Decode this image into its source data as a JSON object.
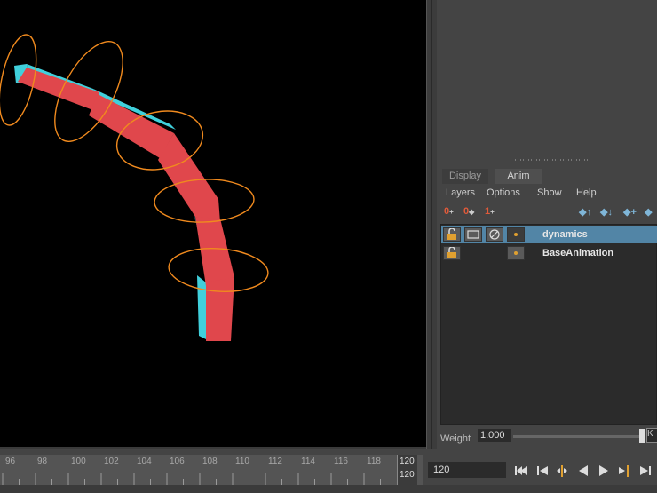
{
  "panel": {
    "tabs": [
      {
        "label": "Display",
        "active": false
      },
      {
        "label": "Anim",
        "active": true
      }
    ],
    "menu": [
      "Layers",
      "Options",
      "Show",
      "Help"
    ],
    "toolbar_left": [
      "0",
      "0",
      "1"
    ],
    "layers": [
      {
        "name": "dynamics",
        "selected": true
      },
      {
        "name": "BaseAnimation",
        "selected": false
      }
    ],
    "weight": {
      "label": "Weight",
      "value": "1.000",
      "key_button": "K"
    }
  },
  "timeline": {
    "ticks": [
      "96",
      "98",
      "100",
      "102",
      "104",
      "106",
      "108",
      "110",
      "112",
      "114",
      "116",
      "118",
      "120"
    ],
    "current_frame": "120"
  },
  "playback": {
    "frame_field": "120",
    "buttons": [
      "go-to-start",
      "step-back-key",
      "step-back-frame",
      "play-back",
      "play-forward",
      "step-forward-key",
      "go-to-end"
    ]
  },
  "colors": {
    "chain_front": "#e0474c",
    "chain_side": "#40d0dc",
    "controls": "#f08a1e",
    "selection": "#5285a6"
  }
}
